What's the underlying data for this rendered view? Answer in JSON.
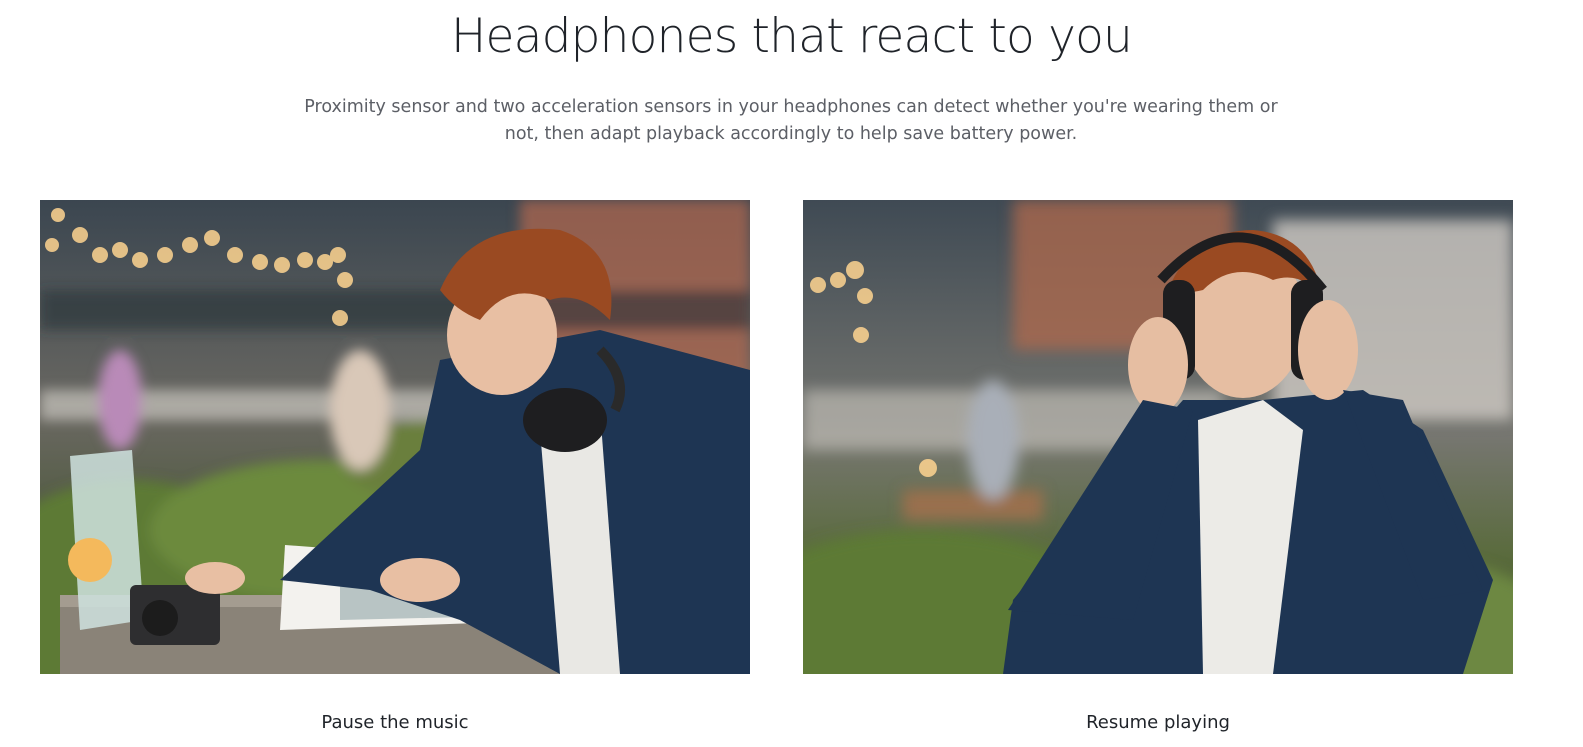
{
  "headline": "Headphones that react to you",
  "description": "Proximity sensor and two acceleration sensors in your headphones can detect whether you're wearing them or not, then adapt playback accordingly to help save battery power.",
  "cards": [
    {
      "caption": "Pause the music"
    },
    {
      "caption": "Resume playing"
    }
  ],
  "colors": {
    "headline": "#1f2329",
    "body_text": "#5c5f66",
    "background": "#ffffff",
    "jacket_navy": "#1e3553",
    "hair_auburn": "#9a4a22",
    "foliage_green": "#4f6e2c"
  }
}
